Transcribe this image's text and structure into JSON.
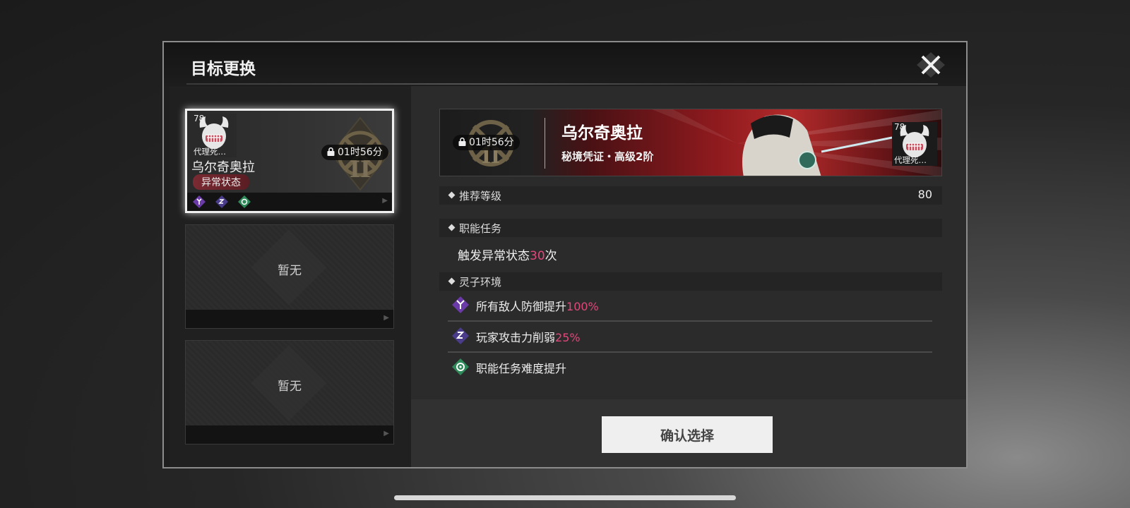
{
  "dialog": {
    "title": "目标更换",
    "close_icon": "close-x-icon"
  },
  "target_list": {
    "selected_card": {
      "avatar_level": "78",
      "avatar_name": "代理死…",
      "boss_name": "乌尔奇奥拉",
      "tag": "异常状态",
      "timer": "01时56分",
      "emblem_numeral": "II",
      "env_icons": [
        "defense-up-icon",
        "sleep-attack-down-icon",
        "mission-difficulty-icon"
      ]
    },
    "empty_cards": [
      {
        "label": "暂无"
      },
      {
        "label": "暂无"
      }
    ]
  },
  "detail": {
    "banner": {
      "timer": "01时56分",
      "emblem_numeral": "II",
      "boss_name": "乌尔奇奥拉",
      "subtitle": "秘境凭证・高级2阶",
      "avatar_level": "78",
      "avatar_name": "代理死…"
    },
    "recommended_level": {
      "label": "推荐等级",
      "value": "80"
    },
    "role_task": {
      "label": "职能任务",
      "text_prefix": "触发异常状态",
      "count": "30",
      "text_suffix": "次"
    },
    "environment": {
      "label": "灵子环境",
      "items": [
        {
          "icon": "defense-up-icon",
          "text": "所有敌人防御提升",
          "value": "100%"
        },
        {
          "icon": "sleep-attack-down-icon",
          "text": "玩家攻击力削弱",
          "value": "25%"
        },
        {
          "icon": "mission-difficulty-icon",
          "text": "职能任务难度提升",
          "value": ""
        }
      ]
    }
  },
  "confirm_button": "确认选择",
  "colors": {
    "highlight": "#e0487a",
    "banner_red": "#8e1a1e",
    "icon_purple": "#6a3aa8",
    "icon_green": "#2f8a5a"
  }
}
